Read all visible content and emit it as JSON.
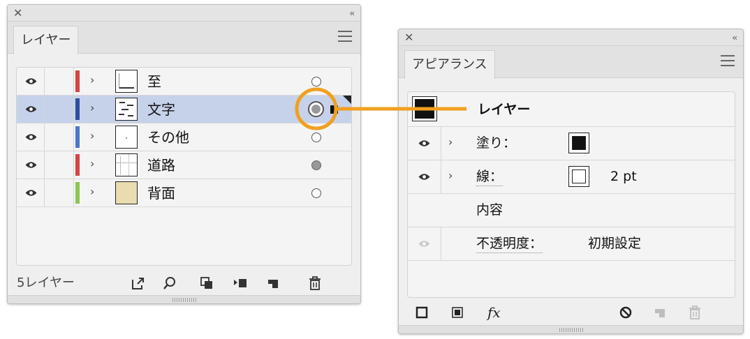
{
  "layers_panel": {
    "tab_label": "レイヤー",
    "layers": [
      {
        "name": "至",
        "color": "#d64541",
        "target": "empty",
        "thumb": "lines"
      },
      {
        "name": "文字",
        "color": "#2f4da1",
        "target": "selected",
        "thumb": "text"
      },
      {
        "name": "その他",
        "color": "#4a78c8",
        "target": "empty",
        "thumb": "blank"
      },
      {
        "name": "道路",
        "color": "#d64541",
        "target": "filled",
        "thumb": "roads"
      },
      {
        "name": "背面",
        "color": "#8ec456",
        "target": "empty",
        "thumb": "beige"
      }
    ],
    "footer_count": "5レイヤー",
    "footer_icons": [
      "export-icon",
      "search-icon",
      "clipping-mask-icon",
      "move-selection-icon",
      "new-layer-icon",
      "trash-icon"
    ]
  },
  "appearance_panel": {
    "tab_label": "アピアランス",
    "header_label": "レイヤー",
    "rows": [
      {
        "label": "塗り：",
        "swatch": "black-fill"
      },
      {
        "label": "線：",
        "swatch": "white-stroke",
        "value": "2 pt"
      },
      {
        "label": "内容"
      },
      {
        "label": "不透明度：",
        "value": "初期設定"
      }
    ],
    "bottom_icons": [
      "add-stroke-icon",
      "add-fill-icon",
      "fx-icon",
      "clear-icon",
      "duplicate-icon",
      "trash-icon"
    ],
    "fx_label": "fx"
  },
  "colors": {
    "highlight_ring": "#f0a020",
    "selected_row": "#c6d2ea"
  }
}
